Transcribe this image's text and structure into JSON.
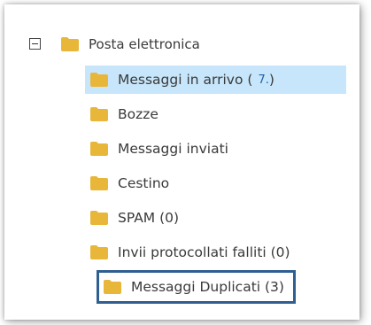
{
  "tree": {
    "root": {
      "label": "Posta elettronica",
      "expanded": true
    },
    "folder_color": "#e8b73a",
    "selection_color": "#c7e6fb",
    "highlight_color": "#2f5f91",
    "items": [
      {
        "label": "Messaggi in arrivo (",
        "count": "7.",
        "suffix": ")",
        "selected": true
      },
      {
        "label": "Bozze"
      },
      {
        "label": "Messaggi inviati"
      },
      {
        "label": "Cestino"
      },
      {
        "label": "SPAM (0)"
      },
      {
        "label": "Invii protocollati falliti (0)"
      },
      {
        "label": "Messaggi Duplicati (3)",
        "highlighted": true
      }
    ]
  }
}
